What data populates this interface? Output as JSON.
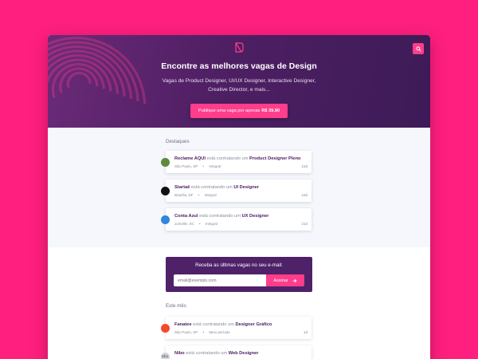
{
  "hero": {
    "title": "Encontre as melhores vagas de Design",
    "subtitle": "Vagas de Product Designer, UI/UX Designer, Interactive Designer, Creative Director, e mais...",
    "cta_text": "Publique uma vaga por apenas",
    "cta_price": "R$ 39,90"
  },
  "featured": {
    "title": "Destaques",
    "jobs": [
      {
        "company": "Reclame AQUI",
        "connector": "está contratando um",
        "role": "Product Designer Pleno",
        "location": "São Paulo, SP",
        "type": "Integral",
        "age": "15d",
        "logo_color": "#5d8a3c",
        "logo_icon": "reclame-aqui-logo-icon"
      },
      {
        "company": "Startaê",
        "connector": "está contratando um",
        "role": "UI Designer",
        "location": "Brasília, DF",
        "type": "Integral",
        "age": "16d",
        "logo_color": "#111111",
        "logo_icon": "startae-logo-icon"
      },
      {
        "company": "Conta Azul",
        "connector": "está contratando um",
        "role": "UX Designer",
        "location": "Joinville, SC",
        "type": "Integral",
        "age": "21d",
        "logo_color": "#2e86de",
        "logo_icon": "conta-azul-check-icon"
      }
    ]
  },
  "newsletter": {
    "title": "Receba as últimas vagas no seu e-mail:",
    "placeholder": "email@exemplo.com",
    "button": "Assinar",
    "button_icon": "arrow-right-icon"
  },
  "month": {
    "title": "Este mês",
    "jobs": [
      {
        "company": "Fanatee",
        "connector": "está contratando um",
        "role": "Designer Gráfico",
        "location": "São Paulo, SP",
        "type": "Meio período",
        "age": "1d",
        "logo_color": "#f24b2a",
        "logo_icon": "fanatee-logo-icon"
      },
      {
        "company": "Nibo",
        "connector": "está contratando um",
        "role": "Web Designer",
        "location": "",
        "type": "",
        "age": "",
        "logo_color": "#cfd4dc",
        "logo_icon": "nibo-logo-icon",
        "logo_text": "nibo"
      }
    ]
  },
  "colors": {
    "background": "#ff1f7e",
    "hero": "#4e1f63",
    "accent": "#ff3d8b",
    "brand_text": "#4e2163"
  }
}
